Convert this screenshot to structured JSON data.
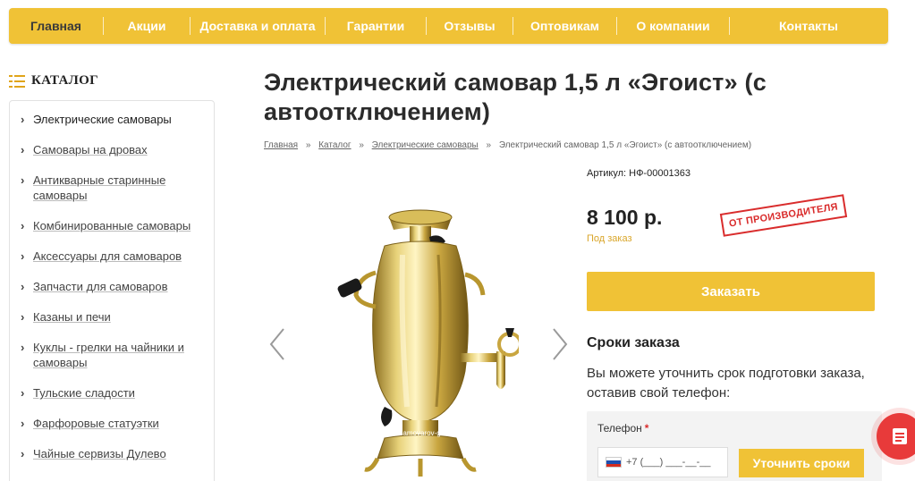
{
  "topnav": {
    "items": [
      "Главная",
      "Акции",
      "Доставка и оплата",
      "Гарантии",
      "Отзывы",
      "Оптовикам",
      "О компании",
      "Контакты"
    ],
    "active_index": 0,
    "accent": "#f0c236"
  },
  "catalog": {
    "title": "КАТАЛОГ",
    "items": [
      "Электрические самовары",
      "Самовары на дровах",
      "Антикварные старинные самовары",
      "Комбинированные самовары",
      "Аксессуары для самоваров",
      "Запчасти для самоваров",
      "Казаны и печи",
      "Куклы - грелки на чайники и самовары",
      "Тульские сладости",
      "Фарфоровые статуэтки",
      "Чайные сервизы Дулево"
    ]
  },
  "product": {
    "title": "Электрический самовар 1,5 л «Эгоист» (с автоотключением)",
    "breadcrumbs": [
      "Главная",
      "Каталог",
      "Электрические самовары"
    ],
    "breadcrumb_current": "Электрический самовар 1,5 л «Эгоист» (с автоотключением)",
    "breadcrumb_separator": "»",
    "article": "Артикул: НФ-00001363",
    "price": "8 100 р.",
    "order_note": "Под заказ",
    "stamp": "ОТ ПРОИЗВОДИТЕЛЯ",
    "order_button": "Заказать",
    "watermark": "samovarov-grad.ru"
  },
  "terms": {
    "title": "Сроки заказа",
    "text": "Вы можете уточнить срок подготовки заказа, оставив свой телефон:",
    "phone_label": "Телефон",
    "required_mark": "*",
    "phone_placeholder": "+7 (___) ___-__-__",
    "submit_button": "Уточнить сроки"
  },
  "icons": [
    "menu-icon",
    "chevron-left-icon",
    "chevron-right-icon",
    "russia-flag-icon",
    "document-icon"
  ]
}
